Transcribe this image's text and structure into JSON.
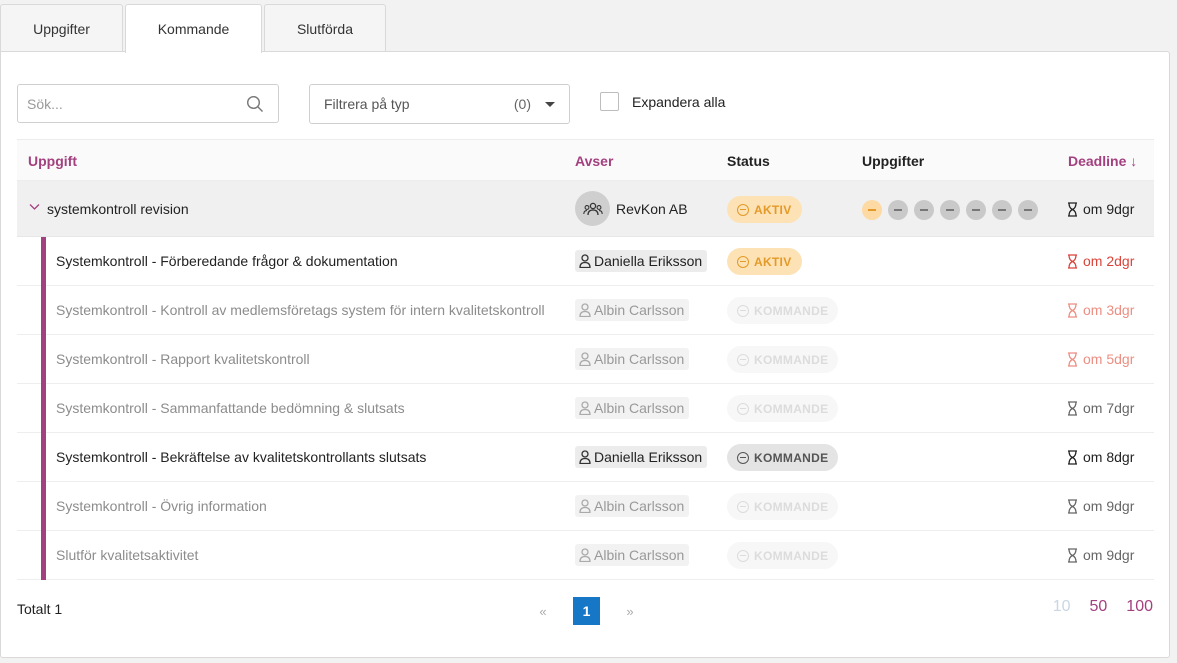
{
  "tabs": [
    {
      "label": "Uppgifter",
      "active": false
    },
    {
      "label": "Kommande",
      "active": true
    },
    {
      "label": "Slutförda",
      "active": false
    }
  ],
  "toolbar": {
    "search_placeholder": "Sök...",
    "filter_label": "Filtrera på typ",
    "filter_count": "(0)",
    "expand_label": "Expandera alla"
  },
  "columns": {
    "task": "Uppgift",
    "concerns": "Avser",
    "status": "Status",
    "tasks": "Uppgifter",
    "deadline": "Deadline ↓"
  },
  "parent": {
    "name": "systemkontroll revision",
    "client": "RevKon AB",
    "status": "AKTIV",
    "deadline": "om 9dgr",
    "progress_dots": 7,
    "progress_active": 1
  },
  "rows": [
    {
      "name": "Systemkontroll - Förberedande frågor & dokumentation",
      "assignee": "Daniella Eriksson",
      "status": "AKTIV",
      "deadline": "om 2dgr"
    },
    {
      "name": "Systemkontroll - Kontroll av medlemsföretags system för intern kvalitetskontroll",
      "assignee": "Albin Carlsson",
      "status": "KOMMANDE",
      "deadline": "om 3dgr"
    },
    {
      "name": "Systemkontroll - Rapport kvalitetskontroll",
      "assignee": "Albin Carlsson",
      "status": "KOMMANDE",
      "deadline": "om 5dgr"
    },
    {
      "name": "Systemkontroll - Sammanfattande bedömning & slutsats",
      "assignee": "Albin Carlsson",
      "status": "KOMMANDE",
      "deadline": "om 7dgr"
    },
    {
      "name": "Systemkontroll - Bekräftelse av kvalitetskontrollants slutsats",
      "assignee": "Daniella Eriksson",
      "status": "KOMMANDE",
      "deadline": "om 8dgr"
    },
    {
      "name": "Systemkontroll - Övrig information",
      "assignee": "Albin Carlsson",
      "status": "KOMMANDE",
      "deadline": "om 9dgr"
    },
    {
      "name": "Slutför kvalitetsaktivitet",
      "assignee": "Albin Carlsson",
      "status": "KOMMANDE",
      "deadline": "om 9dgr"
    }
  ],
  "footer": {
    "total": "Totalt 1",
    "prev": "«",
    "page": "1",
    "next": "»",
    "page_sizes": [
      "10",
      "50",
      "100"
    ]
  },
  "colors": {
    "accent": "#a3407f",
    "aktiv_bg": "#fde2b5",
    "aktiv_fg": "#e49a28",
    "page_active": "#1777c7",
    "deadline_red": "#d9443a"
  }
}
